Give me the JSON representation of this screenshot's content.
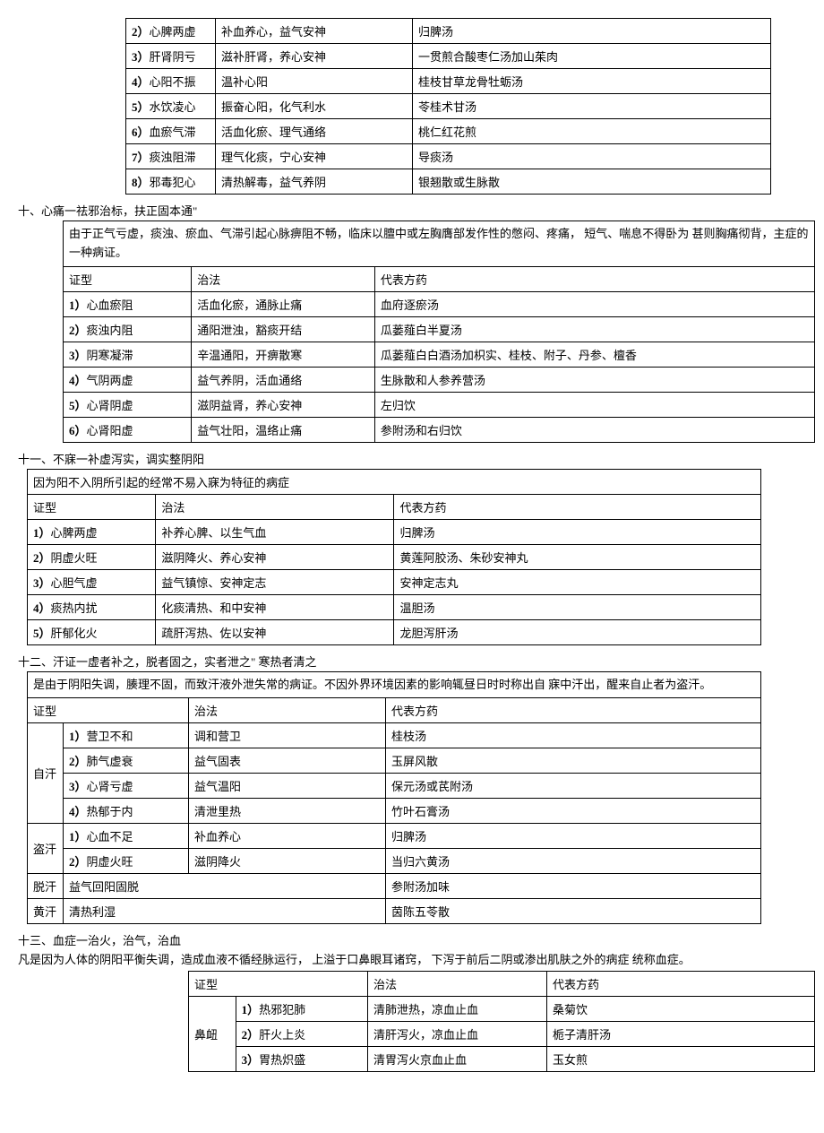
{
  "table_a": {
    "indent": 120,
    "cols": [
      100,
      220,
      400
    ],
    "rows": [
      [
        "2）心脾两虚",
        "补血养心，益气安神",
        "归脾汤"
      ],
      [
        "3）肝肾阴亏",
        "滋补肝肾，养心安神",
        "一贯煎合酸枣仁汤加山茱肉"
      ],
      [
        "4）心阳不振",
        "温补心阳",
        "桂枝甘草龙骨牡蛎汤"
      ],
      [
        "5）水饮凌心",
        "振奋心阳，化气利水",
        "苓桂术甘汤"
      ],
      [
        "6）血瘀气滞",
        "活血化瘀、理气通络",
        "桃仁红花煎"
      ],
      [
        "7）痰浊阻滞",
        "理气化痰，宁心安神",
        "导痰汤"
      ],
      [
        "8）邪毒犯心",
        "清热解毒，益气养阴",
        "银翘散或生脉散"
      ]
    ]
  },
  "section10": {
    "heading": "十、心痛一祛邪治标，扶正固本通\"",
    "intro": "由于正气亏虚，痰浊、瘀血、气滞引起心脉痹阻不畅，临床以膻中或左胸膺部发作性的憋闷、疼痛，  短气、喘息不得卧为    甚则胸痛彻背，主症的一种病证。",
    "header": [
      "证型",
      "治法",
      "代表方药"
    ],
    "rows": [
      [
        "1）心血瘀阻",
        "活血化瘀，通脉止痛",
        "血府逐瘀汤"
      ],
      [
        "2）痰浊内阻",
        "通阳泄浊，豁痰开结",
        "瓜蒌薤白半夏汤"
      ],
      [
        "3）阴寒凝滞",
        "辛温通阳，开痹散寒",
        "瓜蒌薤白白酒汤加枳实、桂枝、附子、丹参、檀香"
      ],
      [
        "4）气阴两虚",
        "益气养阴，活血通络",
        "生脉散和人参养营汤"
      ],
      [
        "5）心肾阴虚",
        "滋阴益肾，养心安神",
        "左归饮"
      ],
      [
        "6）心肾阳虚",
        "益气壮阳，温络止痛",
        "参附汤和右归饮"
      ]
    ]
  },
  "section11": {
    "heading": "十一、不寐一补虚泻实，调实整阴阳",
    "intro": "因为阳不入阴所引起的经常不易入寐为特征的病症",
    "header": [
      "证型",
      "治法",
      "代表方药"
    ],
    "rows": [
      [
        "1）心脾两虚",
        "补养心脾、以生气血",
        "归脾汤"
      ],
      [
        "2）阴虚火旺",
        "滋阴降火、养心安神",
        "黄莲阿胶汤、朱砂安神丸"
      ],
      [
        "3）心胆气虚",
        "益气镇惊、安神定志",
        "安神定志丸"
      ],
      [
        "4）痰热内扰",
        "化痰清热、和中安神",
        "温胆汤"
      ],
      [
        "5）肝郁化火",
        "疏肝泻热、佐以安神",
        "龙胆泻肝汤"
      ]
    ]
  },
  "section12": {
    "heading": "十二、汗证一虚者补之，脱者固之，实者泄之\" 寒热者清之",
    "intro": "是由于阴阳失调，腠理不固，而致汗液外泄失常的病证。不因外界环境因素的影响辄昼日时时称出自  寐中汗出，醒来自止者为盗汗。",
    "header": [
      "证型",
      "",
      "治法",
      "代表方药"
    ],
    "zihan": "自汗",
    "zihan_rows": [
      [
        "1）营卫不和",
        "调和营卫",
        "桂枝汤"
      ],
      [
        "2）肺气虚衰",
        "益气固表",
        "玉屏风散"
      ],
      [
        "3）心肾亏虚",
        "益气温阳",
        "保元汤或芪附汤"
      ],
      [
        "4）热郁于内",
        "清泄里热",
        "竹叶石膏汤"
      ]
    ],
    "daohan": "盗汗",
    "daohan_rows": [
      [
        "1）心血不足",
        "补血养心",
        "归脾汤"
      ],
      [
        "2）阴虚火旺",
        "滋阴降火",
        "当归六黄汤"
      ]
    ],
    "tuohan": [
      "脱汗",
      "益气回阳固脱",
      "参附汤加味"
    ],
    "huanghan": [
      "黄汗",
      "清热利湿",
      "茵陈五苓散"
    ]
  },
  "section13": {
    "heading": "十三、血症一治火，治气，治血",
    "intro": "凡是因为人体的阴阳平衡失调，造成血液不循经脉运行，  上溢于口鼻眼耳诸窍，  下泻于前后二阴或渗出肌肤之外的病症    统称血症。",
    "header": [
      "证型",
      "",
      "治法",
      "代表方药"
    ],
    "binu": "鼻衄",
    "rows": [
      [
        "1）热邪犯肺",
        "清肺泄热，凉血止血",
        "桑菊饮"
      ],
      [
        "2）肝火上炎",
        "清肝泻火，凉血止血",
        "栀子清肝汤"
      ],
      [
        "3）胃热炽盛",
        "清胃泻火京血止血",
        "玉女煎"
      ]
    ]
  }
}
